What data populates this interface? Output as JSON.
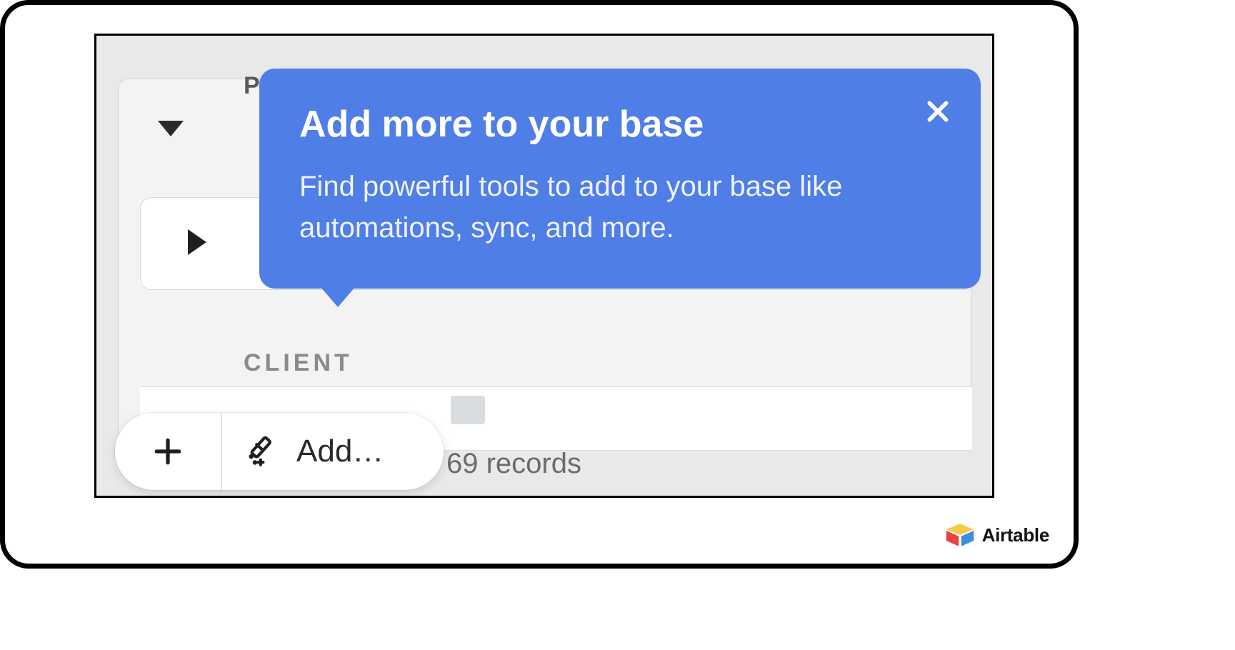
{
  "tooltip": {
    "title": "Add more to your base",
    "body": "Find powerful tools to add to your base like automations, sync, and more."
  },
  "section": {
    "client_label": "CLIENT",
    "records_text": "69 records"
  },
  "add_button": {
    "label": "Add…"
  },
  "brand": {
    "name": "Airtable"
  },
  "colors": {
    "tooltip_bg": "#4f7ee6"
  }
}
